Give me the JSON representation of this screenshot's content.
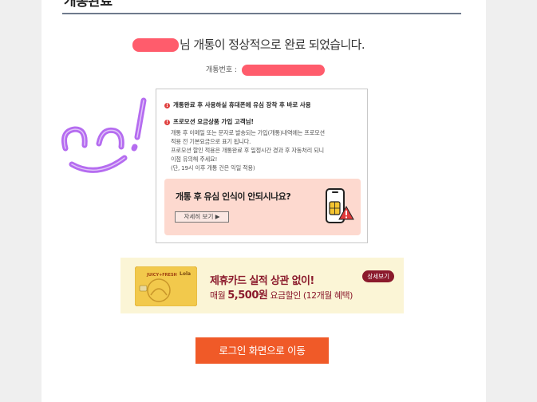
{
  "page": {
    "title": "개통완료"
  },
  "headline": {
    "text": "님 개통이 정상적으로 완료 되었습니다."
  },
  "number": {
    "label": "개통번호 :"
  },
  "notices": [
    {
      "bullet": "!",
      "text": "개통완료 후 사용하실 휴대폰에 유심 장착 후 바로 사용"
    },
    {
      "bullet": "!",
      "text": "프로모션 요금상품 가입 고객님!"
    }
  ],
  "promo_desc": [
    "개통 후 이메일 또는 문자로 발송되는 가입(개통)내역에는 프로모션",
    "적용 전 기본요금으로 표기 됩니다.",
    "프로모션 할인 적용은 개통완료 후 일정시간 경과 후 자동처리 되니",
    "이점 유의해 주세요!",
    "(단, 19시 이후 개통 건은 익일 적용)"
  ],
  "sim_help": {
    "title": "개통 후 유심 인식이 안되시나요?",
    "button_label": "자세히 보기 ▶"
  },
  "card_banner": {
    "headline": "제휴카드 실적 상관 없이!",
    "sub_prefix": "매월 ",
    "sub_amount": "5,500원",
    "sub_suffix": " 요금할인 (12개월 혜택)",
    "detail_label": "상세보기",
    "card_brand": "Lola",
    "card_name": "JUICY+FRESH"
  },
  "login_button": {
    "label": "로그인 화면으로 이동"
  },
  "colors": {
    "accent": "#f05a28",
    "banner_text": "#8b1a2c",
    "redaction": "#ff5c6c",
    "sim_box_bg": "#fdd9cf"
  }
}
